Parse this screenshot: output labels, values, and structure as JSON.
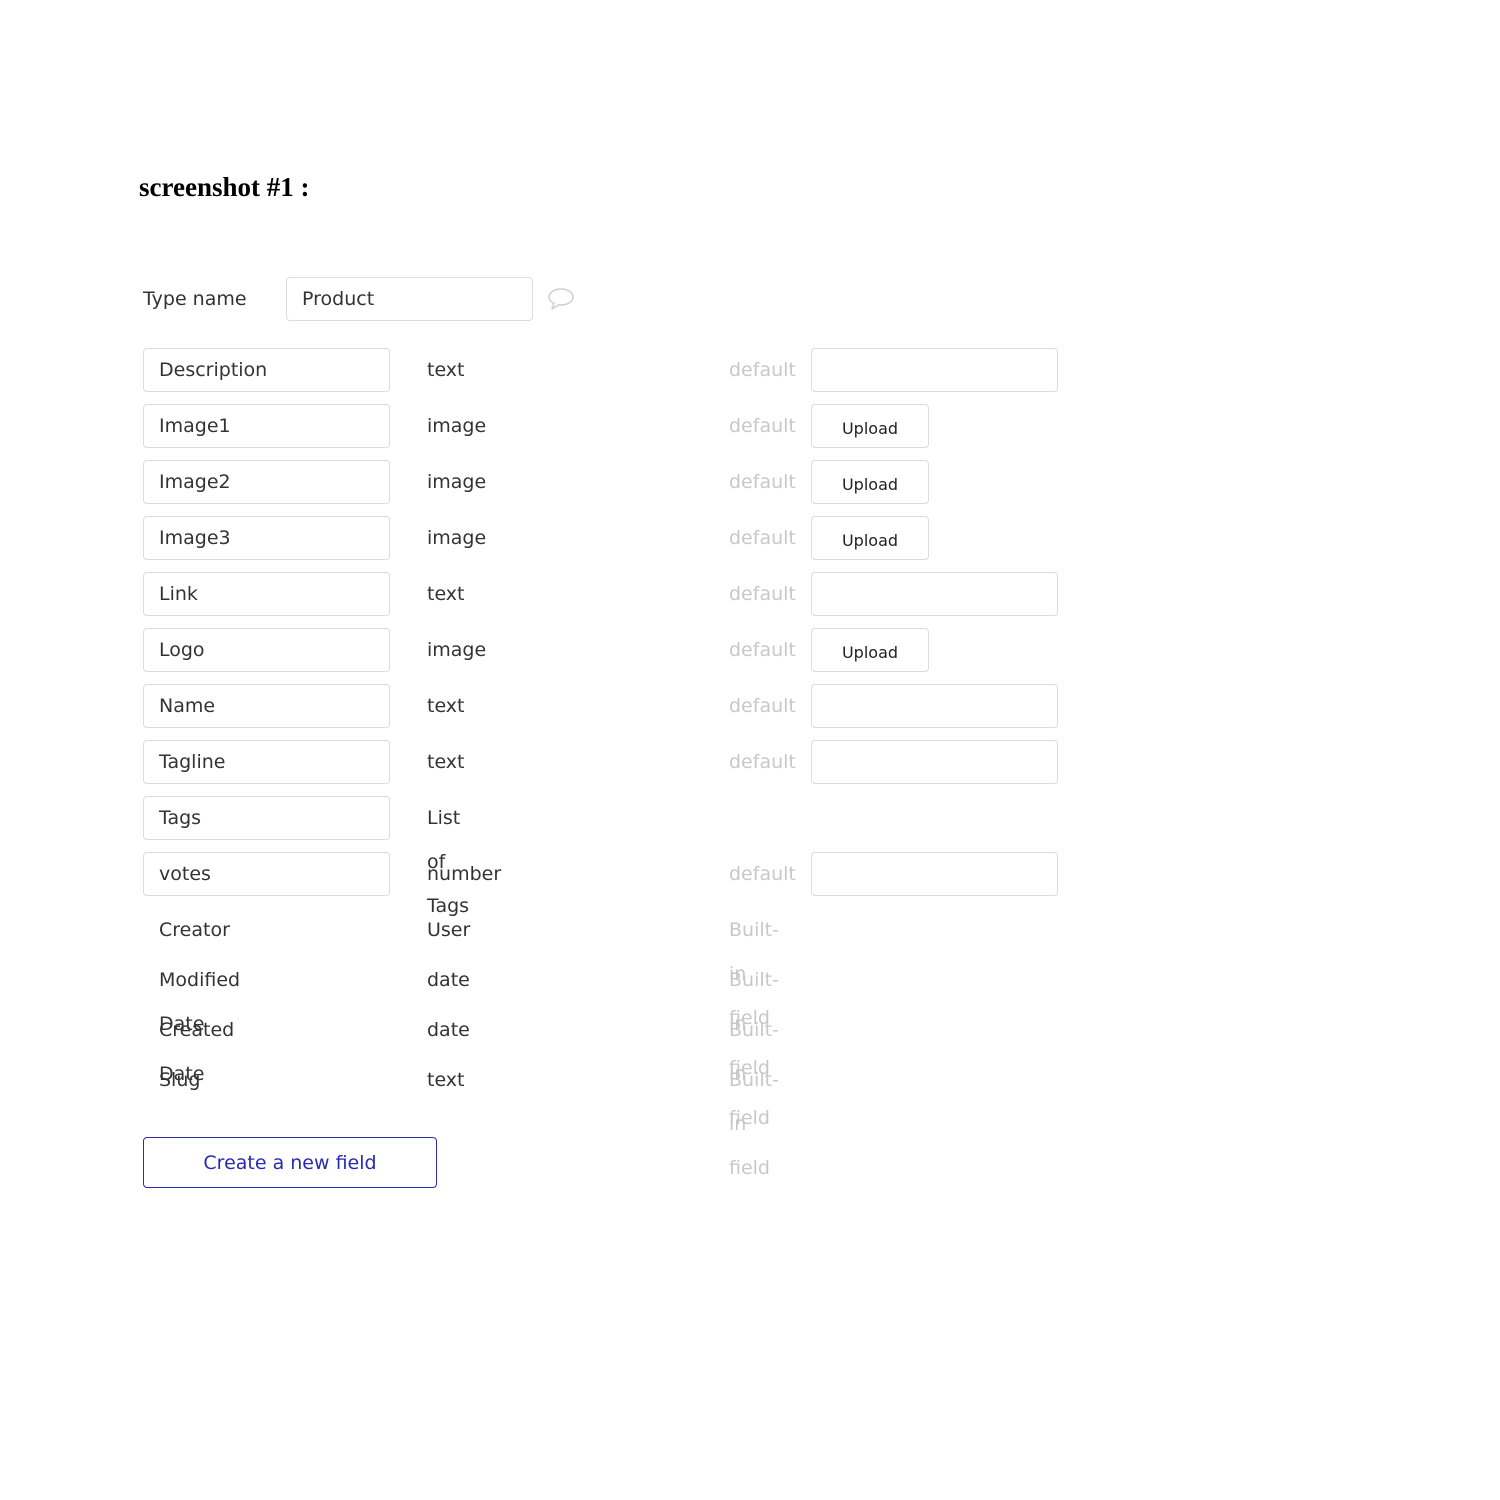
{
  "heading": "screenshot #1 :",
  "type_name": {
    "label": "Type name",
    "value": "Product",
    "comment_icon": "speech-bubble-icon"
  },
  "default_label": "default",
  "upload_label": "Upload",
  "fields": [
    {
      "name": "Description",
      "type": "text",
      "default": "text-input"
    },
    {
      "name": "Image1",
      "type": "image",
      "default": "upload"
    },
    {
      "name": "Image2",
      "type": "image",
      "default": "upload"
    },
    {
      "name": "Image3",
      "type": "image",
      "default": "upload"
    },
    {
      "name": "Link",
      "type": "text",
      "default": "text-input"
    },
    {
      "name": "Logo",
      "type": "image",
      "default": "upload"
    },
    {
      "name": "Name",
      "type": "text",
      "default": "text-input"
    },
    {
      "name": "Tagline",
      "type": "text",
      "default": "text-input"
    },
    {
      "name": "Tags",
      "type": "List of Tags",
      "default": "none"
    },
    {
      "name": "votes",
      "type": "number",
      "default": "text-input"
    }
  ],
  "builtin_note": "Built-in field",
  "builtin_fields": [
    {
      "name": "Creator",
      "type": "User"
    },
    {
      "name": "Modified Date",
      "type": "date"
    },
    {
      "name": "Created Date",
      "type": "date"
    },
    {
      "name": "Slug",
      "type": "text"
    }
  ],
  "create_button": "Create a new field",
  "colors": {
    "accent": "#2a2ab0",
    "muted": "#c8c8c8",
    "border": "#dcdcdc"
  }
}
